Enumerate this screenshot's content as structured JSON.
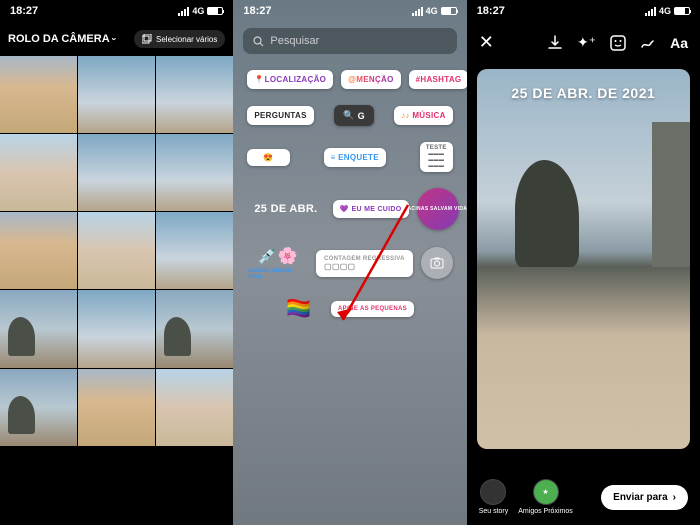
{
  "status": {
    "time": "18:27",
    "network": "4G"
  },
  "screen1": {
    "header_title": "ROLO DA CÂMERA",
    "select_label": "Selecionar vários"
  },
  "screen2": {
    "search_placeholder": "Pesquisar",
    "stickers": {
      "localizacao": "LOCALIZAÇÃO",
      "mencao": "@MENÇÃO",
      "hashtag": "#HASHTAG",
      "perguntas": "PERGUNTAS",
      "gif": "G",
      "musica": "MÚSICA",
      "emoji": "😍",
      "enquete": "ENQUETE",
      "teste": "TESTE",
      "data": "25 DE ABR.",
      "eu_me_cuido": "EU ME CUIDO",
      "vacinas": "VACINAS SALVAM VIDAS",
      "vacinas2": "vacinas salvam vidas",
      "contagem": "CONTAGEM REGRESSIVA",
      "apoie": "APOIE AS PEQUENAS"
    }
  },
  "screen3": {
    "date_text": "25 DE ABR. DE 2021",
    "toolbar_text": "Aa",
    "your_story": "Seu story",
    "close_friends": "Amigos Próximos",
    "send_to": "Enviar para"
  }
}
